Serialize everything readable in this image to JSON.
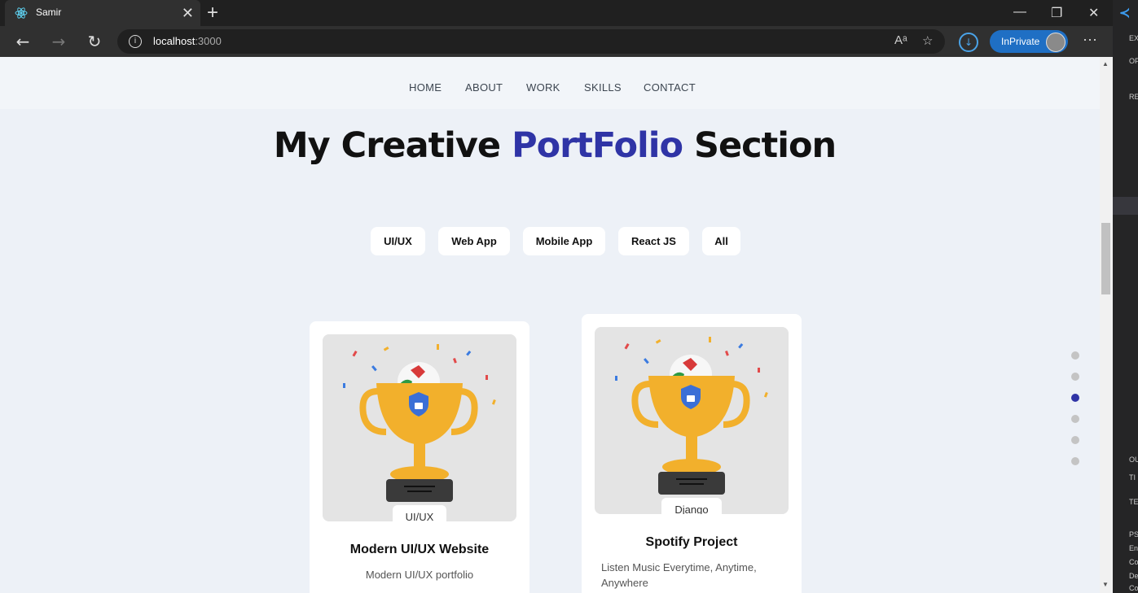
{
  "browser": {
    "tab_title": "Samir",
    "tab_close": "✕",
    "new_tab": "+",
    "window_controls": [
      "—",
      "❐",
      "✕"
    ],
    "nav_buttons": [
      "←",
      "→",
      "↻"
    ],
    "address_host": "localhost",
    "address_port": ":3000",
    "inprivate_label": "InPrivate",
    "more": "···"
  },
  "nav": {
    "items": [
      "HOME",
      "ABOUT",
      "WORK",
      "SKILLS",
      "CONTACT"
    ]
  },
  "heading": {
    "part1": "My Creative ",
    "accent": "PortFolio",
    "part2": " Section"
  },
  "filters": [
    "UI/UX",
    "Web App",
    "Mobile App",
    "React JS",
    "All"
  ],
  "cards": [
    {
      "tag": "UI/UX",
      "title": "Modern UI/UX Website",
      "desc": "Modern UI/UX portfolio"
    },
    {
      "tag": "Django",
      "title": "Spotify Project",
      "desc": "Listen Music Everytime, Anytime, Anywhere"
    }
  ],
  "section_dots": {
    "count": 6,
    "active_index": 2
  },
  "colors": {
    "accent": "#2f34a6",
    "page_bg": "#edf1f7",
    "trophy_gold": "#f2b02c"
  },
  "vscode": {
    "lines": [
      "EX",
      "OP",
      "RE",
      "OU",
      "TI",
      "TE",
      "PS",
      "En",
      "Co",
      "De",
      "Co"
    ]
  }
}
